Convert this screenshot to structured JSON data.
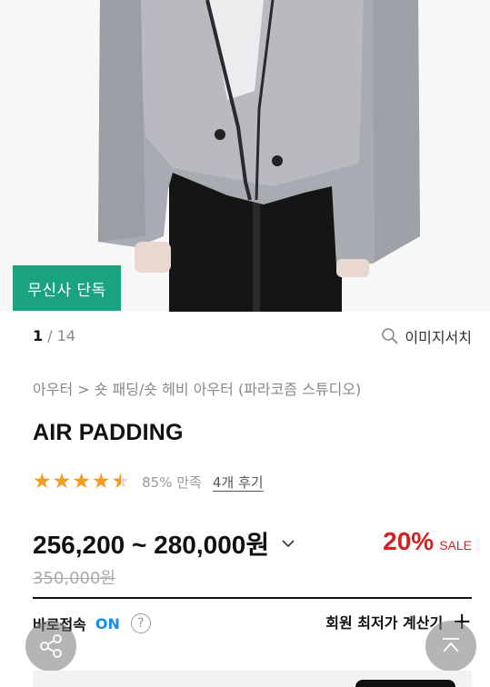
{
  "product": {
    "badge": "무신사 단독",
    "pager_current": "1",
    "pager_total": "/ 14",
    "image_search_label": "이미지서치",
    "breadcrumb": "아우터 > 숏 패딩/숏 헤비 아우터 (파라코즘 스튜디오)",
    "title": "AIR PADDING",
    "rating": 4.5,
    "rating_max": 5,
    "satisfaction": "85% 만족",
    "reviews": "4개 후기",
    "price_range": "256,200 ~ 280,000원",
    "discount_percent": "20%",
    "sale_label": "SALE",
    "original_price": "350,000원",
    "direct_label": "바로접속",
    "direct_status": "ON",
    "help_symbol": "?",
    "member_price_label": "회원 최저가 계산기",
    "plus_symbol": "+"
  },
  "colors": {
    "badge_green": "#1aa37f",
    "star_orange": "#f39c1f",
    "sale_red": "#d72020",
    "on_blue": "#1a8ce6"
  },
  "icons": {
    "image_search": "search-icon",
    "price_dropdown": "chevron-down-icon",
    "help": "question-icon",
    "share": "share-icon",
    "scroll_top": "arrow-up-icon"
  }
}
